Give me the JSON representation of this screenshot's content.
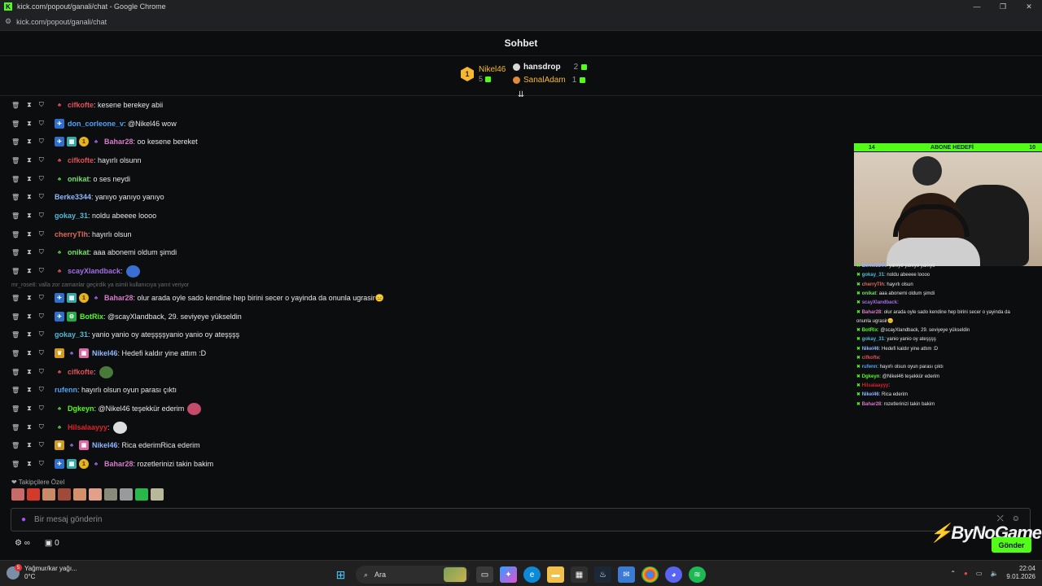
{
  "window": {
    "title": "kick.com/popout/ganali/chat - Google Chrome",
    "url": "kick.com/popout/ganali/chat",
    "controls": [
      "—",
      "❐",
      "✕"
    ]
  },
  "header": {
    "title": "Sohbet"
  },
  "leaderboard": {
    "first": {
      "rank": "1",
      "name": "Nikel46",
      "count": "5"
    },
    "second": {
      "name": "hansdrop",
      "count": "2"
    },
    "third": {
      "name": "SanalAdam",
      "count": "1"
    }
  },
  "messages": [
    {
      "user": "cifkofte",
      "color": "#e0505a",
      "text": ": kesene berekey abii",
      "badges": [
        "leaf"
      ]
    },
    {
      "user": "don_corleone_v",
      "color": "#4fa3f7",
      "text": ": @Nikel46 wow",
      "badges": [
        "blue"
      ]
    },
    {
      "user": "Bahar28",
      "color": "#d979c9",
      "text": ": oo kesene bereket",
      "badges": [
        "blue",
        "grid",
        "gold",
        "leaf-purple"
      ]
    },
    {
      "user": "cifkofte",
      "color": "#e0505a",
      "text": ": hayırlı olsunn",
      "badges": [
        "leaf"
      ]
    },
    {
      "user": "onikat",
      "color": "#75e06b",
      "text": ": o ses neydi",
      "badges": [
        "leaf-green"
      ]
    },
    {
      "user": "Berke3344",
      "color": "#8fb7ff",
      "text": ": yanıyo yanıyo yanıyo",
      "badges": []
    },
    {
      "user": "gokay_31",
      "color": "#4fb9d6",
      "text": ": noldu abeeee loooo",
      "badges": []
    },
    {
      "user": "cherryTlh",
      "color": "#e06a5a",
      "text": ": hayırlı olsun",
      "badges": []
    },
    {
      "user": "onikat",
      "color": "#75e06b",
      "text": ": aaa abonemi oldum şimdi",
      "badges": [
        "leaf-green"
      ]
    },
    {
      "user": "scayXlandback",
      "color": "#a46de8",
      "text": ":",
      "badges": [
        "leaf"
      ],
      "emote": "#3a6fd1"
    },
    {
      "user": "Bahar28",
      "color": "#d979c9",
      "text": ": olur arada oyle sado kendine hep birini secer o yayinda da onunla ugrasir😑",
      "badges": [
        "blue",
        "grid",
        "gold",
        "leaf-purple"
      ]
    },
    {
      "user": "BotRix",
      "color": "#53fc18",
      "text": ": @scayXlandback, 29. seviyeye yükseldin",
      "badges": [
        "blue",
        "bot"
      ]
    },
    {
      "user": "gokay_31",
      "color": "#4fb9d6",
      "text": ": yanio yanio oy ateşşşşyanio yanio oy ateşşşş",
      "badges": []
    },
    {
      "user": "Nikel46",
      "color": "#8fb7ff",
      "text": ": Hedefi kaldır yine attım :D",
      "badges": [
        "crown",
        "leaf-purple",
        "gift"
      ]
    },
    {
      "user": "cifkofte",
      "color": "#e0505a",
      "text": ":",
      "badges": [
        "leaf"
      ],
      "emote": "#4a7a3a"
    },
    {
      "user": "rufenn",
      "color": "#4fa3f7",
      "text": ": hayırlı olsun oyun parası çıktı",
      "badges": []
    },
    {
      "user": "Dgkeyn",
      "color": "#53fc18",
      "text": ": @Nikel46 teşekkür ederim",
      "badges": [
        "leaf-green"
      ],
      "emote": "#c64a6a"
    },
    {
      "user": "Hilsalaayyy",
      "color": "#e0202a",
      "text": ":",
      "badges": [
        "leaf-green"
      ],
      "emote": "#dddddd"
    },
    {
      "user": "Nikel46",
      "color": "#8fb7ff",
      "text": ": Rica ederimRica ederim",
      "badges": [
        "crown",
        "leaf-purple",
        "gift"
      ]
    },
    {
      "user": "Bahar28",
      "color": "#d979c9",
      "text": ": rozetlerinizi takin bakim",
      "badges": [
        "blue",
        "grid",
        "gold",
        "leaf-purple"
      ]
    }
  ],
  "reply_line": "mr_rose8: valla zor zamanlar geçirdik ya isimli kullanıcıya yanıt veriyor",
  "followers_label": "❤ Takipçilere Özel",
  "composer": {
    "placeholder": "Bir mesaj gönderin"
  },
  "bottom_tools": {
    "count": "0"
  },
  "send_label": "Gönder",
  "watermark": "ByNoGame",
  "sub_goal": {
    "left": "14",
    "label": "ABONE HEDEFİ",
    "right": "10"
  },
  "overlay_chat": [
    {
      "user": "Berke3344",
      "color": "#8fb7ff",
      "text": ": yanıyo yanıyo yanıyo"
    },
    {
      "user": "gokay_31",
      "color": "#4fb9d6",
      "text": ": noldu abeeee loooo"
    },
    {
      "user": "cherryTlh",
      "color": "#e06a5a",
      "text": ": hayırlı olsun"
    },
    {
      "user": "onikat",
      "color": "#75e06b",
      "text": ": aaa abonemi oldum şimdi"
    },
    {
      "user": "scayXlandback",
      "color": "#a46de8",
      "text": ":"
    },
    {
      "user": "Bahar28",
      "color": "#d979c9",
      "text": ": olur arada oyle sado kendine hep birini secer o yayinda da"
    },
    {
      "user": "",
      "color": "#e8e8e8",
      "text": "onunla ugrasir😑"
    },
    {
      "user": "BotRix",
      "color": "#53fc18",
      "text": ": @scayXlandback, 29. seviyeye yükseldin"
    },
    {
      "user": "gokay_31",
      "color": "#4fb9d6",
      "text": ": yanio yanio oy ateşşşş"
    },
    {
      "user": "Nikel46",
      "color": "#8fb7ff",
      "text": ": Hedefi kaldır yine attım :D"
    },
    {
      "user": "cifkofte",
      "color": "#e0505a",
      "text": ":"
    },
    {
      "user": "rufenn",
      "color": "#4fa3f7",
      "text": ": hayırlı olsun oyun parası çıktı"
    },
    {
      "user": "Dgkeyn",
      "color": "#53fc18",
      "text": ": @Nikel46 teşekkür ederim"
    },
    {
      "user": "Hilsalaayyy",
      "color": "#e0202a",
      "text": ":"
    },
    {
      "user": "Nikel46",
      "color": "#8fb7ff",
      "text": ": Rica ederim"
    },
    {
      "user": "Bahar28",
      "color": "#d979c9",
      "text": ": rozetlerinizi takin bakim"
    }
  ],
  "taskbar": {
    "weather": {
      "line1": "Yağmur/kar yağı...",
      "line2": "0°C"
    },
    "search": "Ara",
    "time": "22:04",
    "date": "9.01.2026"
  },
  "colors": {
    "accent": "#53fc18",
    "background": "#0b0d0e"
  }
}
